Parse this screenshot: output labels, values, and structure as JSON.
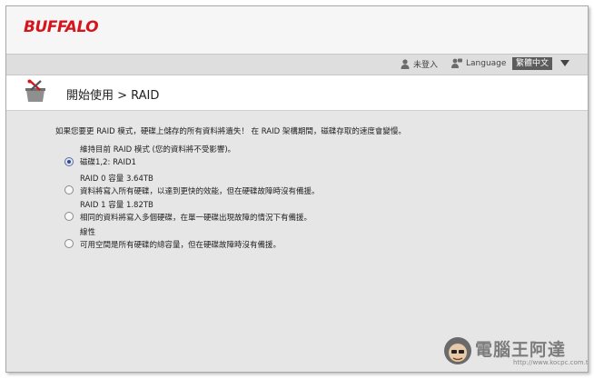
{
  "brand": {
    "logo_text": "BUFFALO"
  },
  "util_bar": {
    "user_label": "未登入",
    "language_label": "Language",
    "language_selected": "繁體中文"
  },
  "header": {
    "breadcrumb": "開始使用 > RAID"
  },
  "content": {
    "intro": "如果您要更 RAID 模式，硬碟上儲存的所有資料將遺失！  在 RAID 架構期間，磁碟存取的速度會變慢。",
    "options": [
      {
        "title": "維持目前 RAID 模式 (您的資料將不受影響)。",
        "detail": "磁碟1,2: RAID1",
        "selected": true
      },
      {
        "title": "RAID 0 容量 3.64TB",
        "detail": "資料將寫入所有硬碟，以達到更快的效能，但在硬碟故障時沒有備援。",
        "selected": false
      },
      {
        "title": "RAID 1 容量 1.82TB",
        "detail": "相同的資料將寫入多個硬碟，在單一硬碟出現故障的情況下有備援。",
        "selected": false
      },
      {
        "title": "線性",
        "detail": "可用空間是所有硬碟的總容量，但在硬碟故障時沒有備援。",
        "selected": false
      }
    ]
  },
  "watermark": {
    "text": "電腦王阿達",
    "url": "http://www.kocpc.com.tw"
  },
  "colors": {
    "brand_red": "#d6141e",
    "select_bg": "#5c5c5c",
    "page_bg": "#e6e6e6"
  }
}
